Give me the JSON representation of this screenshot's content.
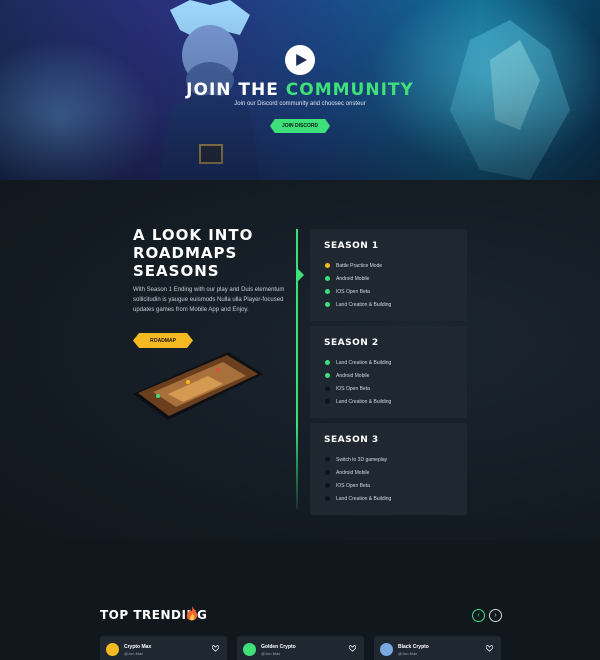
{
  "hero": {
    "title_main": "JOIN THE ",
    "title_accent": "COMMUNITY",
    "subtitle": "Join our Discord community and choosec onsteur",
    "button_label": "JOIN DISCORD"
  },
  "roadmap": {
    "title_line1": "A LOOK INTO",
    "title_line2": "ROADMAPS",
    "title_line3": "SEASONS",
    "description": "With Season 1 Ending with our play and Duis elementum sollicitudin is yaugue euismods Nulla ulla Player-focused updates games from Mobile App and Enjoy.",
    "button_label": "ROADMAP",
    "seasons": [
      {
        "title": "SEASON 1",
        "items": [
          {
            "label": "Battle Practice Mode",
            "status": "yellow"
          },
          {
            "label": "Android Mobile",
            "status": "green"
          },
          {
            "label": "IOS Open Beta",
            "status": "green"
          },
          {
            "label": "Land Creation & Building",
            "status": "green"
          }
        ]
      },
      {
        "title": "SEASON 2",
        "items": [
          {
            "label": "Land Creation & Building",
            "status": "green"
          },
          {
            "label": "Android Mobile",
            "status": "green"
          },
          {
            "label": "IOS Open Beta",
            "status": "none"
          },
          {
            "label": "Land Creation & Building",
            "status": "none"
          }
        ]
      },
      {
        "title": "SEASON 3",
        "items": [
          {
            "label": "Switch to 3D gameplay",
            "status": "none"
          },
          {
            "label": "Android Mobile",
            "status": "none"
          },
          {
            "label": "IOS Open Beta",
            "status": "none"
          },
          {
            "label": "Land Creation & Building",
            "status": "none"
          }
        ]
      }
    ]
  },
  "trending": {
    "title": "TOP TRENDING",
    "prev_icon": "‹",
    "next_icon": "›",
    "cards": [
      {
        "name": "Crypto Max",
        "handle": "@Jon.Max",
        "avatar_color": "#f5b921"
      },
      {
        "name": "Golden Crypto",
        "handle": "@Jon.Max",
        "avatar_color": "#3ee07a"
      },
      {
        "name": "Black Crypto",
        "handle": "@Jon.Max",
        "avatar_color": "#7aa8e0"
      }
    ]
  },
  "colors": {
    "accent_green": "#3ee07a",
    "accent_yellow": "#f5b921",
    "background": "#10171d",
    "card": "#1f2731"
  }
}
